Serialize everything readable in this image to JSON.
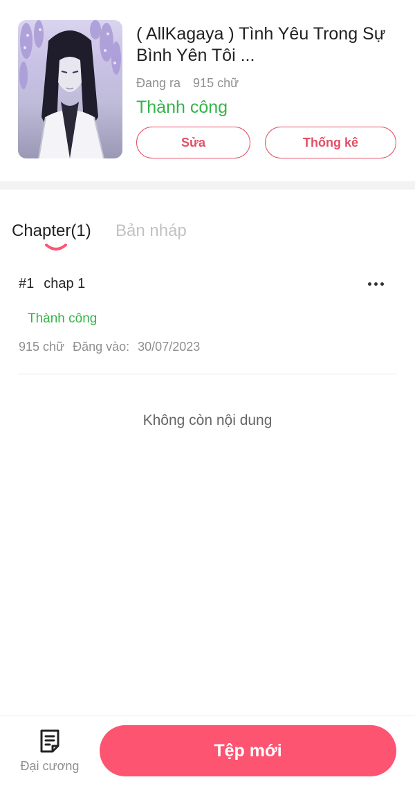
{
  "story": {
    "title": "( AllKagaya ) Tình Yêu Trong Sự Bình Yên Tôi ...",
    "serial_status": "Đang ra",
    "word_count": "915 chữ",
    "review_status": "Thành công",
    "edit_label": "Sửa",
    "stats_label": "Thống kê"
  },
  "tabs": {
    "chapters": "Chapter(1)",
    "drafts": "Bản nháp"
  },
  "chapters": [
    {
      "number": "#1",
      "title": "chap 1",
      "status": "Thành công",
      "word_count": "915 chữ",
      "posted_label": "Đăng vào:",
      "posted_date": "30/07/2023"
    }
  ],
  "empty_note": "Không còn nội dung",
  "bottom_bar": {
    "outline_label": "Đại cương",
    "new_file_label": "Tệp mới"
  },
  "colors": {
    "accent": "#fd5471",
    "outline_accent": "#e24f63",
    "success": "#35b34a"
  },
  "icons": {
    "more": "more-horizontal-icon",
    "outline": "document-list-icon"
  }
}
